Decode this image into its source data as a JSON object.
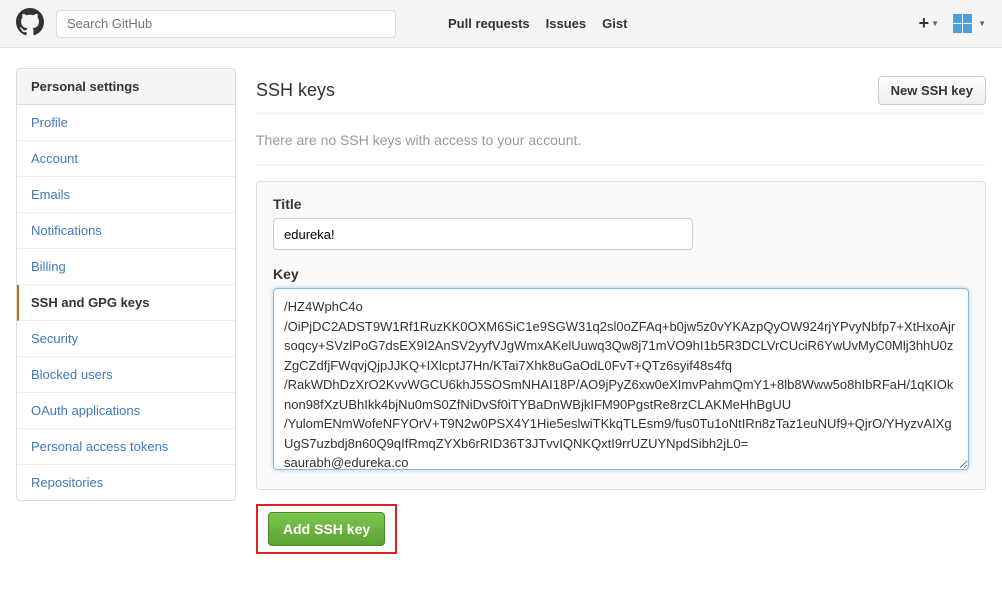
{
  "header": {
    "search_placeholder": "Search GitHub",
    "nav": {
      "pull_requests": "Pull requests",
      "issues": "Issues",
      "gist": "Gist"
    }
  },
  "sidebar": {
    "title": "Personal settings",
    "items": [
      {
        "label": "Profile"
      },
      {
        "label": "Account"
      },
      {
        "label": "Emails"
      },
      {
        "label": "Notifications"
      },
      {
        "label": "Billing"
      },
      {
        "label": "SSH and GPG keys"
      },
      {
        "label": "Security"
      },
      {
        "label": "Blocked users"
      },
      {
        "label": "OAuth applications"
      },
      {
        "label": "Personal access tokens"
      },
      {
        "label": "Repositories"
      }
    ]
  },
  "main": {
    "heading": "SSH keys",
    "new_button": "New SSH key",
    "empty_msg": "There are no SSH keys with access to your account.",
    "title_label": "Title",
    "title_value": "edureka!",
    "key_label": "Key",
    "key_value": "/HZ4WphC4o\n/OiPjDC2ADST9W1Rf1RuzKK0OXM6SiC1e9SGW31q2sl0oZFAq+b0jw5z0vYKAzpQyOW924rjYPvyNbfp7+XtHxoAjrsoqcy+SVzlPoG7dsEX9I2AnSV2yyfVJgWmxAKelUuwq3Qw8j71mVO9hI1b5R3DCLVrCUciR6YwUvMyC0Mlj3hhU0zZgCZdfjFWqvjQjpJJKQ+IXlcptJ7Hn/KTai7Xhk8uGaOdL0FvT+QTz6syif48s4fq\n/RakWDhDzXrO2KvvWGCU6khJ5SOSmNHAI18P/AO9jPyZ6xw0eXImvPahmQmY1+8lb8Www5o8hIbRFaH/1qKIOknon98fXzUBhIkk4bjNu0mS0ZfNiDvSf0iTYBaDnWBjkIFM90PgstRe8rzCLAKMeHhBgUU\n/YulomENmWofeNFYOrV+T9N2w0PSX4Y1Hie5eslwiTKkqTLEsm9/fus0Tu1oNtIRn8zTaz1euNUf9+QjrO/YHyzvAIXgUgS7uzbdj8n60Q9qIfRmqZYXb6rRID36T3JTvvIQNKQxtI9rrUZUYNpdSibh2jL0=\nsaurabh@edureka.co",
    "add_button": "Add SSH key"
  }
}
